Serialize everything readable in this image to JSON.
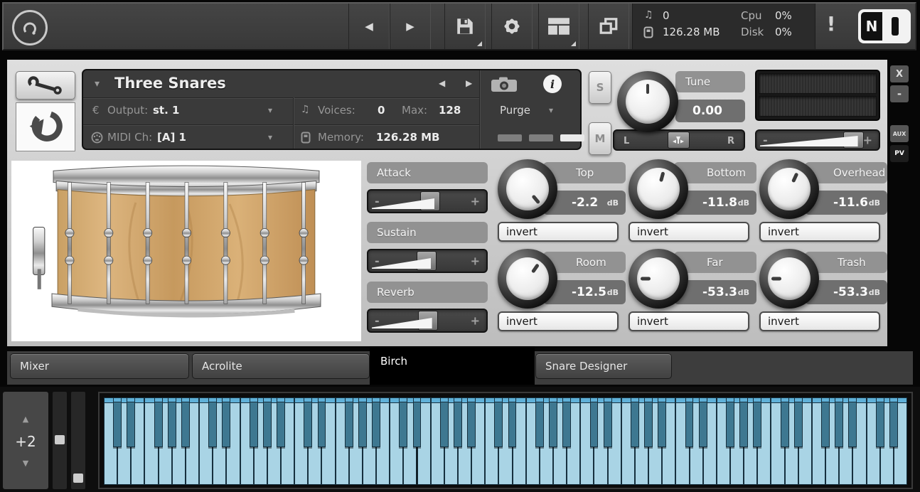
{
  "icons": {
    "back": "◀",
    "fwd": "▶",
    "caret_down": "▾",
    "up": "▲",
    "down": "▼",
    "note": "♫",
    "minus": "-",
    "plus": "+",
    "info": "i",
    "euro_output": "€"
  },
  "toolbar": {
    "voices_value": "0",
    "memory_value": "126.28 MB",
    "cpu_label": "Cpu",
    "cpu_value": "0%",
    "disk_label": "Disk",
    "disk_value": "0%",
    "alert": "!",
    "ni_text": "N"
  },
  "header": {
    "title": "Three Snares",
    "output_label": "Output:",
    "output_value": "st. 1",
    "midi_label": "MIDI Ch:",
    "midi_value": "[A] 1",
    "voices_label": "Voices:",
    "voices_value": "0",
    "max_label": "Max:",
    "max_value": "128",
    "memory_label": "Memory:",
    "memory_value": "126.28 MB",
    "purge_label": "Purge"
  },
  "panel_buttons": {
    "close": "X",
    "minimize": "-",
    "aux": "AUX",
    "pv": "PV"
  },
  "master": {
    "solo_label": "S",
    "mute_label": "M",
    "tune_label": "Tune",
    "tune_value": "0.00",
    "tune_angle": 0,
    "pan_left": "L",
    "pan_right": "R",
    "pan_handle_pct": 41,
    "vol_handle_pct": 71,
    "vol_wedge_pct": 80
  },
  "env_sliders": [
    {
      "label": "Attack",
      "handle_pct": 44,
      "wedge_pct": 53
    },
    {
      "label": "Sustain",
      "handle_pct": 41,
      "wedge_pct": 50
    },
    {
      "label": "Reverb",
      "handle_pct": 42,
      "wedge_pct": 51
    }
  ],
  "mics": [
    {
      "label": "Top",
      "value": "-2.2",
      "unit": "dB",
      "invert_label": "invert",
      "angle": 140
    },
    {
      "label": "Bottom",
      "value": "-11.8",
      "unit": "dB",
      "invert_label": "invert",
      "angle": 15
    },
    {
      "label": "Overhead",
      "value": "-11.6",
      "unit": "dB",
      "invert_label": "invert",
      "angle": 25
    },
    {
      "label": "Room",
      "value": "-12.5",
      "unit": "dB",
      "invert_label": "invert",
      "angle": 35
    },
    {
      "label": "Far",
      "value": "-53.3",
      "unit": "dB",
      "invert_label": "invert",
      "angle": -90
    },
    {
      "label": "Trash",
      "value": "-53.3",
      "unit": "dB",
      "invert_label": "invert",
      "angle": -90
    }
  ],
  "tabs": [
    {
      "label": "Mixer",
      "active": false
    },
    {
      "label": "Acrolite",
      "active": false
    },
    {
      "label": "Birch",
      "active": true
    },
    {
      "label": "Snare Designer",
      "active": false
    }
  ],
  "keyboard": {
    "transpose_value": "+2",
    "white_key_count": 59,
    "white_color": "#a9d4e5",
    "black_color": "#3e7891",
    "cap_color": "#5fb0d8",
    "outline_color": "#16303e"
  }
}
